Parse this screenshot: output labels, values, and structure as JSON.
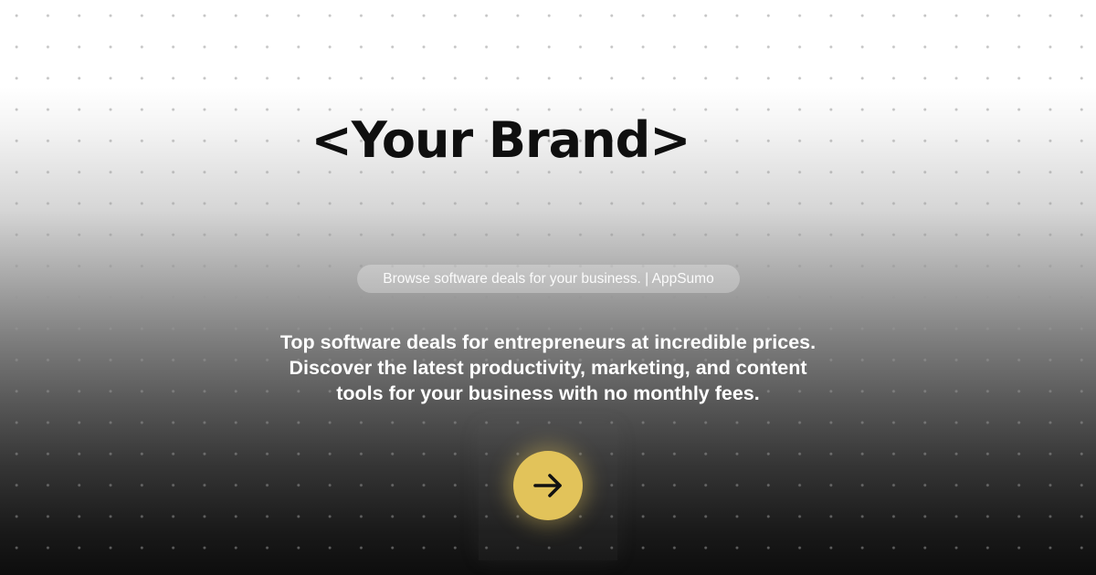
{
  "brand": {
    "title": "<Your Brand>"
  },
  "header": {
    "pill_text": "Browse software deals for your business. | AppSumo"
  },
  "main": {
    "description": "Top software deals for entrepreneurs at incredible prices. Discover the latest productivity, marketing, and content tools for your business with no monthly fees."
  },
  "cta": {
    "icon": "arrow-right-icon",
    "color": "#e2c35a"
  }
}
